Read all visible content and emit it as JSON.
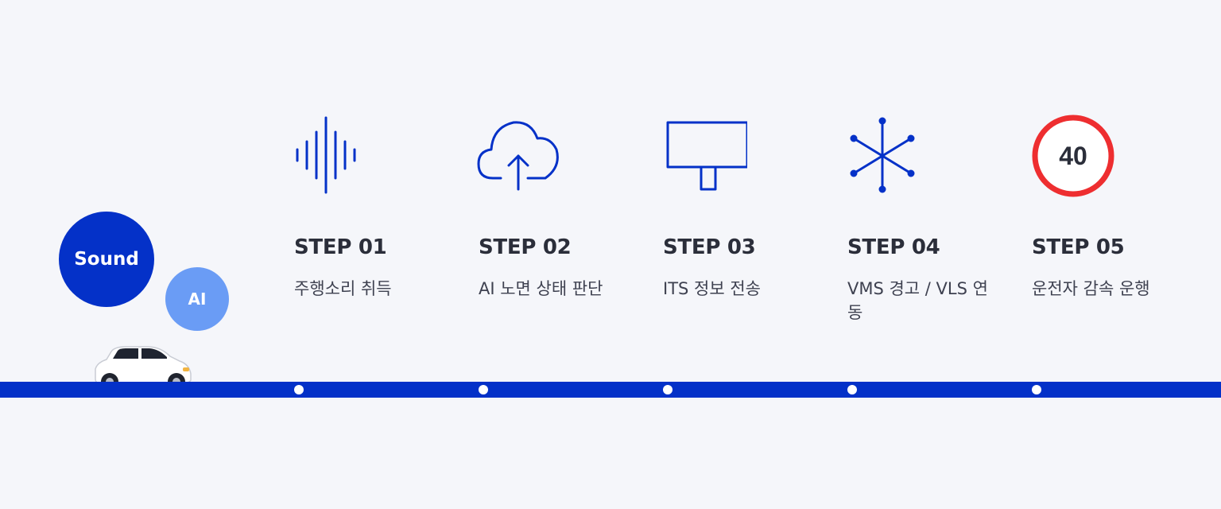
{
  "bubbles": {
    "sound": "Sound",
    "ai": "AI"
  },
  "colors": {
    "primary": "#0431c8",
    "ai_bubble": "#6a9cf5",
    "speed_limit_ring": "#ee2e30",
    "background": "#f5f6fa"
  },
  "steps": [
    {
      "label": "STEP 01",
      "desc": "주행소리 취득",
      "icon": "sound-wave-icon"
    },
    {
      "label": "STEP 02",
      "desc": "AI 노면 상태 판단",
      "icon": "cloud-upload-icon"
    },
    {
      "label": "STEP 03",
      "desc": "ITS 정보 전송",
      "icon": "monitor-icon"
    },
    {
      "label": "STEP 04",
      "desc": "VMS 경고 / VLS 연동",
      "icon": "snowflake-icon"
    },
    {
      "label": "STEP 05",
      "desc": "운전자 감속 운행",
      "icon": "speed-limit-sign-icon",
      "speed_limit": "40"
    }
  ]
}
